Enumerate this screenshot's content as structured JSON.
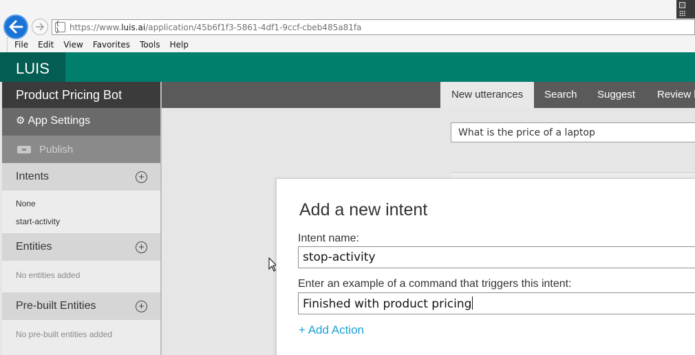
{
  "browser": {
    "url_prefix": "https://www.",
    "url_host": "luis.ai",
    "url_path": "/application/45b6f1f3-5861-4df1-9ccf-cbeb485a81fa",
    "site_icon": "{ }",
    "menu": [
      "File",
      "Edit",
      "View",
      "Favorites",
      "Tools",
      "Help"
    ]
  },
  "header": {
    "logo": "LUIS",
    "accent_color": "#007f6e"
  },
  "sidebar": {
    "app_title": "Product Pricing Bot",
    "app_settings": "App Settings",
    "publish": "Publish",
    "intents": {
      "title": "Intents",
      "items": [
        "None",
        "start-activity"
      ]
    },
    "entities": {
      "title": "Entities",
      "empty": "No entities added"
    },
    "prebuilt": {
      "title": "Pre-built Entities",
      "empty": "No pre-built entities added"
    }
  },
  "tabs": [
    "New utterances",
    "Search",
    "Suggest",
    "Review l"
  ],
  "utterance": {
    "value": "What is the price of a laptop"
  },
  "dialog": {
    "title": "Add a new intent",
    "intent_label": "Intent name:",
    "intent_value": "stop-activity",
    "example_label": "Enter an example of a command that triggers this intent:",
    "example_value": "Finished with product pricing",
    "add_action": "+ Add Action"
  }
}
